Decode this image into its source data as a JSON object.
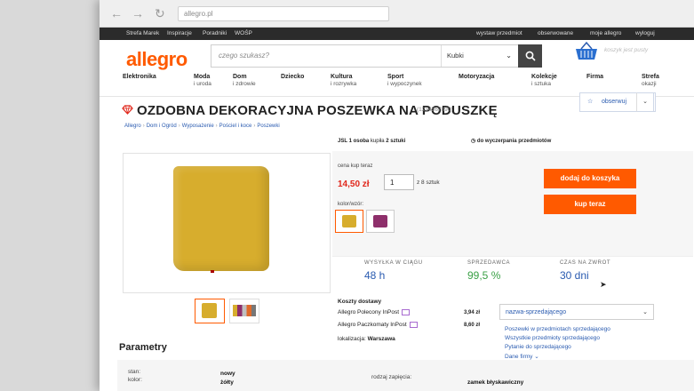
{
  "browser": {
    "url": "allegro.pl"
  },
  "topbar": {
    "left": [
      "Strefa Marek",
      "Inspiracje",
      "Poradniki",
      "WOŚP"
    ],
    "right": [
      "wystaw przedmiot",
      "obserwowane",
      "moje allegro",
      "wyloguj"
    ]
  },
  "header": {
    "logo": "allegro",
    "search_placeholder": "czego szukasz?",
    "search_category": "Kubki",
    "cart_empty_text": "koszyk jest pusty"
  },
  "categories": [
    {
      "name": "Elektronika",
      "sub": ""
    },
    {
      "name": "Moda",
      "sub": "i uroda"
    },
    {
      "name": "Dom",
      "sub": "i zdrowie"
    },
    {
      "name": "Dziecko",
      "sub": ""
    },
    {
      "name": "Kultura",
      "sub": "i rozrywka"
    },
    {
      "name": "Sport",
      "sub": "i wypoczynek"
    },
    {
      "name": "Motoryzacja",
      "sub": ""
    },
    {
      "name": "Kolekcje",
      "sub": "i sztuka"
    },
    {
      "name": "Firma",
      "sub": ""
    },
    {
      "name": "Strefa",
      "sub": "okazji"
    }
  ],
  "product": {
    "title": "OZDOBNA DEKORACYJNA POSZEWKA NA PODUSZKĘ",
    "id": "(1234567890)",
    "observe_label": "obserwuj",
    "breadcrumb": [
      "Allegro",
      "Dom i Ogród",
      "Wyposażenie",
      "Pościel i koce",
      "Poszewki"
    ],
    "promo_prefix": "JSL 1 osoba",
    "promo_middle": "kupiła",
    "promo_suffix": "2 sztuki",
    "timer_text": "do wyczerpania przedmiotów",
    "buy_now_label": "cena kup teraz",
    "price": "14,50 zł",
    "quantity": "1",
    "quantity_of": "z 8 sztuk",
    "color_label": "kolor/wzór:",
    "swatches": [
      "#d7ad2d",
      "#8e2f6b"
    ],
    "add_to_cart": "dodaj do koszyka",
    "buy_now": "kup teraz",
    "stats": [
      {
        "label": "WYSYŁKA W CIĄGU",
        "value": "48 h",
        "color": "#2a5bb0"
      },
      {
        "label": "SPRZEDAWCA",
        "value": "99,5 %",
        "color": "#3aa046"
      },
      {
        "label": "CZAS NA ZWROT",
        "value": "30 dni",
        "color": "#2a5bb0"
      }
    ],
    "shipping_header": "Koszty dostawy",
    "shipping": [
      {
        "name": "Allegro Polecony InPost",
        "price": "3,94 zł"
      },
      {
        "name": "Allegro Paczkomaty InPost",
        "price": "8,60 zł"
      }
    ],
    "location_label": "lokalizacja:",
    "location": "Warszawa",
    "seller_name": "nazwa-sprzedającego",
    "seller_links": [
      "Poszewki w przedmiotach sprzedającego",
      "Wszystkie przedmioty sprzedającego",
      "Pytanie do sprzedającego",
      "Dane firmy ⌄"
    ]
  },
  "params": {
    "title": "Parametry",
    "rows": [
      {
        "label": "stan:",
        "value": "nowy"
      },
      {
        "label": "kolor:",
        "value": "żółty"
      },
      {
        "label": "rodzaj zapięcia:",
        "value": "zamek błyskawiczny"
      }
    ]
  },
  "colors": {
    "accent": "#ff5a00",
    "link": "#2a5bb0",
    "price": "#e0261a"
  }
}
